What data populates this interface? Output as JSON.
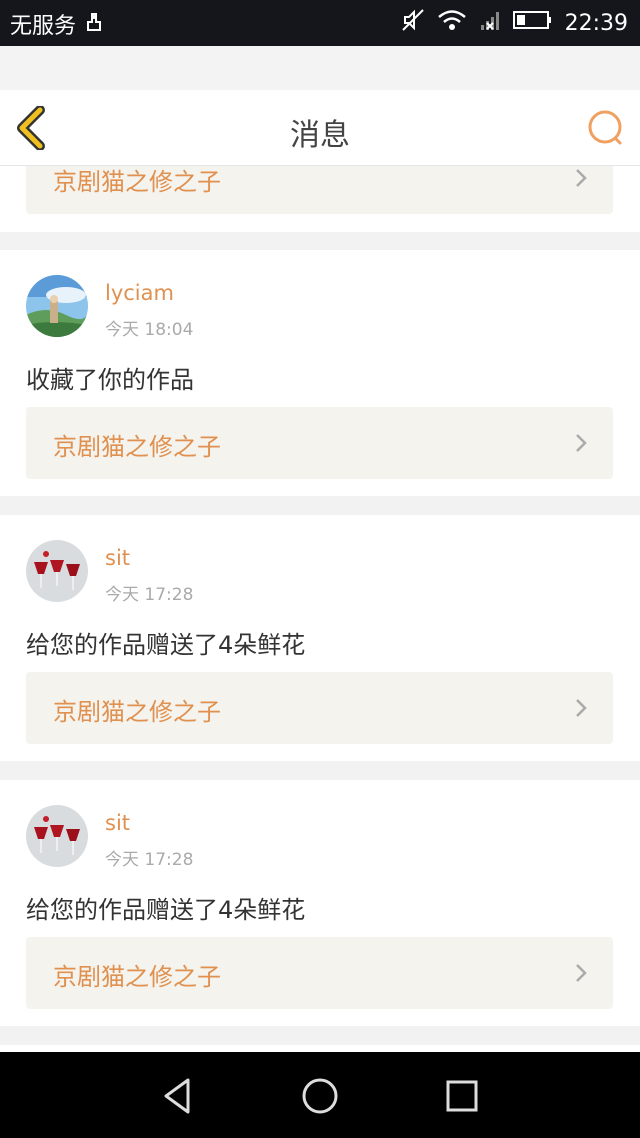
{
  "status_bar": {
    "carrier": "无服务",
    "time": "22:39",
    "icons": [
      "usb-icon",
      "mute-icon",
      "wifi-icon",
      "signal-icon",
      "battery-icon"
    ]
  },
  "header": {
    "title": "消息",
    "back_icon": "chevron-left-icon",
    "search_icon": "search-icon"
  },
  "partial_card": {
    "work_title": "京剧猫之修之子"
  },
  "messages": [
    {
      "username": "lyciam",
      "time": "今天 18:04",
      "action": "收藏了你的作品",
      "work_title": "京剧猫之修之子",
      "avatar_icon": "landscape-avatar"
    },
    {
      "username": "sit",
      "time": "今天 17:28",
      "action": "给您的作品赠送了4朵鲜花",
      "work_title": "京剧猫之修之子",
      "avatar_icon": "glasses-avatar"
    },
    {
      "username": "sit",
      "time": "今天 17:28",
      "action": "给您的作品赠送了4朵鲜花",
      "work_title": "京剧猫之修之子",
      "avatar_icon": "glasses-avatar"
    }
  ],
  "nav_bar": {
    "icons": [
      "back-triangle-icon",
      "home-circle-icon",
      "recents-square-icon"
    ]
  },
  "colors": {
    "accent": "#e0904f",
    "back_arrow": "#f0c020",
    "link_bg": "#f4f3ee"
  }
}
